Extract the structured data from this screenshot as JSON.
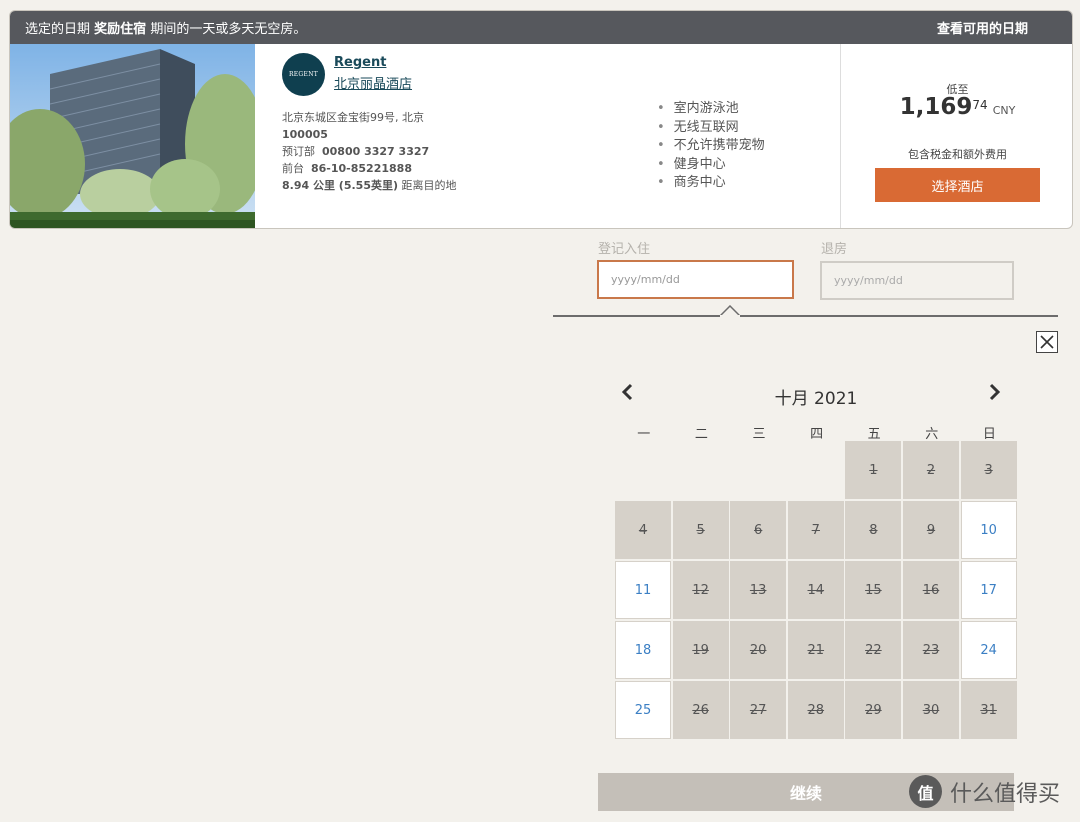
{
  "notice": {
    "prefix": "选定的日期",
    "bold": "奖励住宿",
    "suffix": "期间的一天或多天无空房。",
    "link": "查看可用的日期"
  },
  "hotel": {
    "logo_text": "REGENT",
    "brand": "Regent",
    "name": "北京丽晶酒店",
    "address_line1": "北京东城区金宝街99号, 北京",
    "address_line2": "100005",
    "reservation_label": "预订部",
    "reservation_phone": "00800 3327 3327",
    "frontdesk_label": "前台",
    "frontdesk_phone": "86-10-85221888",
    "distance_value": "8.94 公里 (5.55英里)",
    "distance_suffix": "距离目的地",
    "amenities": [
      "室内游泳池",
      "无线互联网",
      "不允许携带宠物",
      "健身中心",
      "商务中心"
    ]
  },
  "price": {
    "from_label": "低至",
    "integer": "1,169",
    "decimal": "74",
    "currency": "CNY",
    "tax_note": "包含税金和额外费用",
    "select_label": "选择酒店"
  },
  "dates": {
    "checkin_label": "登记入住",
    "checkin_placeholder": "yyyy/mm/dd",
    "checkout_label": "退房",
    "checkout_placeholder": "yyyy/mm/dd"
  },
  "calendar": {
    "month_title": "十月  2021",
    "weekdays": [
      "一",
      "二",
      "三",
      "四",
      "五",
      "六",
      "日"
    ],
    "days": [
      {
        "d": "1",
        "avail": false
      },
      {
        "d": "2",
        "avail": false
      },
      {
        "d": "3",
        "avail": false
      },
      {
        "d": "4",
        "avail": false
      },
      {
        "d": "5",
        "avail": false
      },
      {
        "d": "6",
        "avail": false
      },
      {
        "d": "7",
        "avail": false
      },
      {
        "d": "8",
        "avail": false
      },
      {
        "d": "9",
        "avail": false
      },
      {
        "d": "10",
        "avail": true
      },
      {
        "d": "11",
        "avail": true
      },
      {
        "d": "12",
        "avail": false
      },
      {
        "d": "13",
        "avail": false
      },
      {
        "d": "14",
        "avail": false
      },
      {
        "d": "15",
        "avail": false
      },
      {
        "d": "16",
        "avail": false
      },
      {
        "d": "17",
        "avail": true
      },
      {
        "d": "18",
        "avail": true
      },
      {
        "d": "19",
        "avail": false
      },
      {
        "d": "20",
        "avail": false
      },
      {
        "d": "21",
        "avail": false
      },
      {
        "d": "22",
        "avail": false
      },
      {
        "d": "23",
        "avail": false
      },
      {
        "d": "24",
        "avail": true
      },
      {
        "d": "25",
        "avail": true
      },
      {
        "d": "26",
        "avail": false
      },
      {
        "d": "27",
        "avail": false
      },
      {
        "d": "28",
        "avail": false
      },
      {
        "d": "29",
        "avail": false
      },
      {
        "d": "30",
        "avail": false
      },
      {
        "d": "31",
        "avail": false
      }
    ],
    "first_weekday_index": 4
  },
  "continue_label": "继续",
  "watermark": {
    "icon_text": "值",
    "text": "什么值得买"
  },
  "icons": {
    "prev": "chevron-left-icon",
    "next": "chevron-right-icon",
    "close": "close-icon"
  }
}
